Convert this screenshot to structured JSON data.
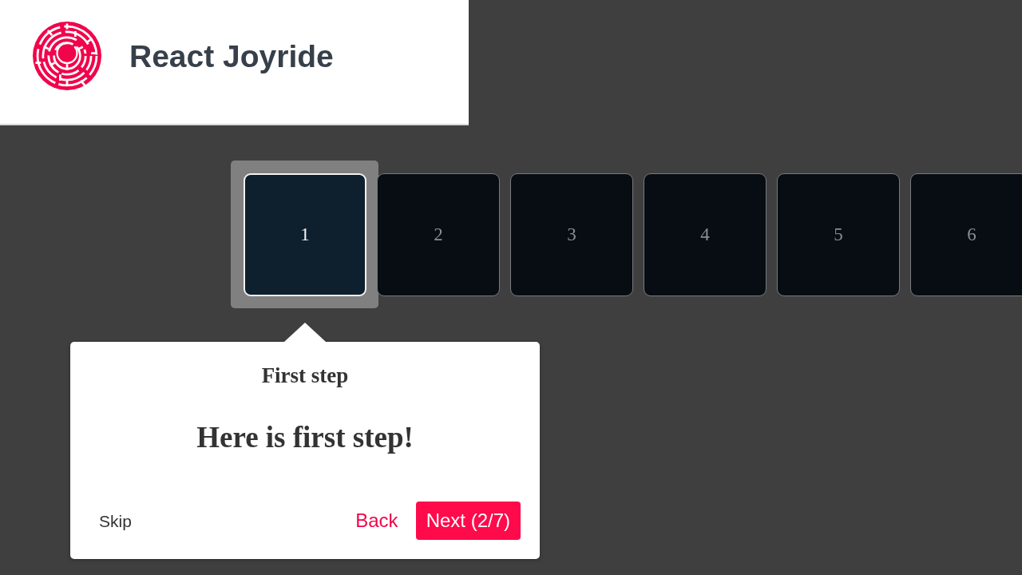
{
  "header": {
    "title": "React Joyride"
  },
  "steps": [
    {
      "label": "1",
      "selected": true
    },
    {
      "label": "2",
      "selected": false
    },
    {
      "label": "3",
      "selected": false
    },
    {
      "label": "4",
      "selected": false
    },
    {
      "label": "5",
      "selected": false
    },
    {
      "label": "6",
      "selected": false
    }
  ],
  "tour_tooltip": {
    "title": "First step",
    "content": "Here is first step!",
    "buttons": [
      {
        "kind": "skip",
        "label": "Skip"
      },
      {
        "kind": "back",
        "label": "Back"
      },
      {
        "kind": "primary",
        "label": "Next (2/7)"
      }
    ]
  }
}
